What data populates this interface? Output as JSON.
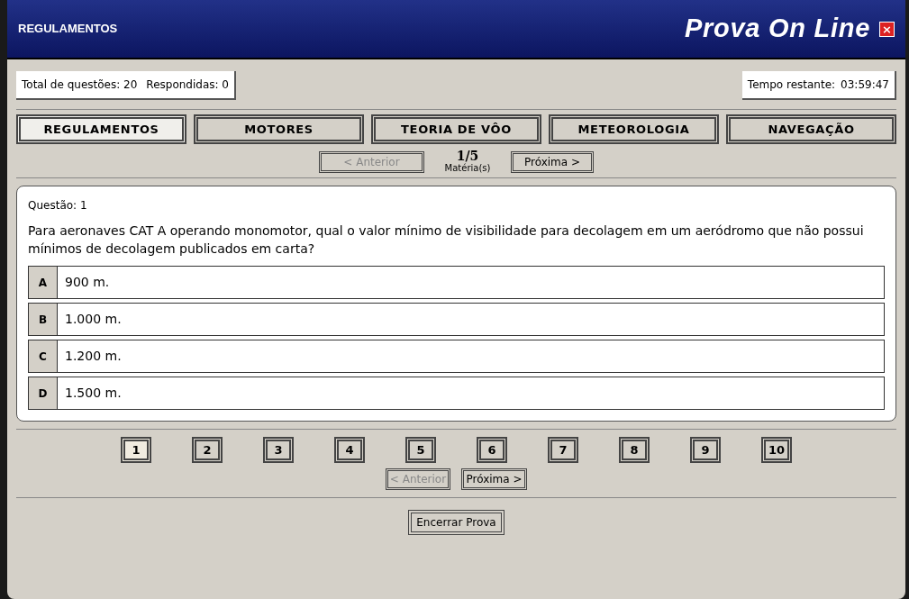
{
  "header": {
    "section": "REGULAMENTOS",
    "title": "Prova On Line",
    "close": "×"
  },
  "stats": {
    "total_label": "Total de questões: 20",
    "answered_label": "Respondidas: 0",
    "time_label": "Tempo restante:",
    "time_value": "03:59:47"
  },
  "tabs": [
    {
      "label": "REGULAMENTOS",
      "selected": true
    },
    {
      "label": "MOTORES",
      "selected": false
    },
    {
      "label": "TEORIA DE VÔO",
      "selected": false
    },
    {
      "label": "METEOROLOGIA",
      "selected": false
    },
    {
      "label": "NAVEGAÇÃO",
      "selected": false
    }
  ],
  "subject_pager": {
    "prev": {
      "label": "< Anterior",
      "disabled": true
    },
    "counter": "1/5",
    "caption": "Matéria(s)",
    "next": {
      "label": "Próxima >",
      "disabled": false
    }
  },
  "question": {
    "number_label": "Questão: 1",
    "text": "Para aeronaves CAT A operando monomotor, qual o valor mínimo de visibilidade para decolagem em um aeródromo que não possui mínimos de decolagem publicados em carta?",
    "options": [
      {
        "letter": "A",
        "text": "900 m."
      },
      {
        "letter": "B",
        "text": "1.000 m."
      },
      {
        "letter": "C",
        "text": "1.200 m."
      },
      {
        "letter": "D",
        "text": "1.500 m."
      }
    ]
  },
  "question_numbers": [
    {
      "label": "1",
      "selected": true
    },
    {
      "label": "2",
      "selected": false
    },
    {
      "label": "3",
      "selected": false
    },
    {
      "label": "4",
      "selected": false
    },
    {
      "label": "5",
      "selected": false
    },
    {
      "label": "6",
      "selected": false
    },
    {
      "label": "7",
      "selected": false
    },
    {
      "label": "8",
      "selected": false
    },
    {
      "label": "9",
      "selected": false
    },
    {
      "label": "10",
      "selected": false
    }
  ],
  "question_pager": {
    "prev": {
      "label": "< Anterior",
      "disabled": true
    },
    "next": {
      "label": "Próxima >",
      "disabled": false
    }
  },
  "finish_button": "Encerrar Prova"
}
